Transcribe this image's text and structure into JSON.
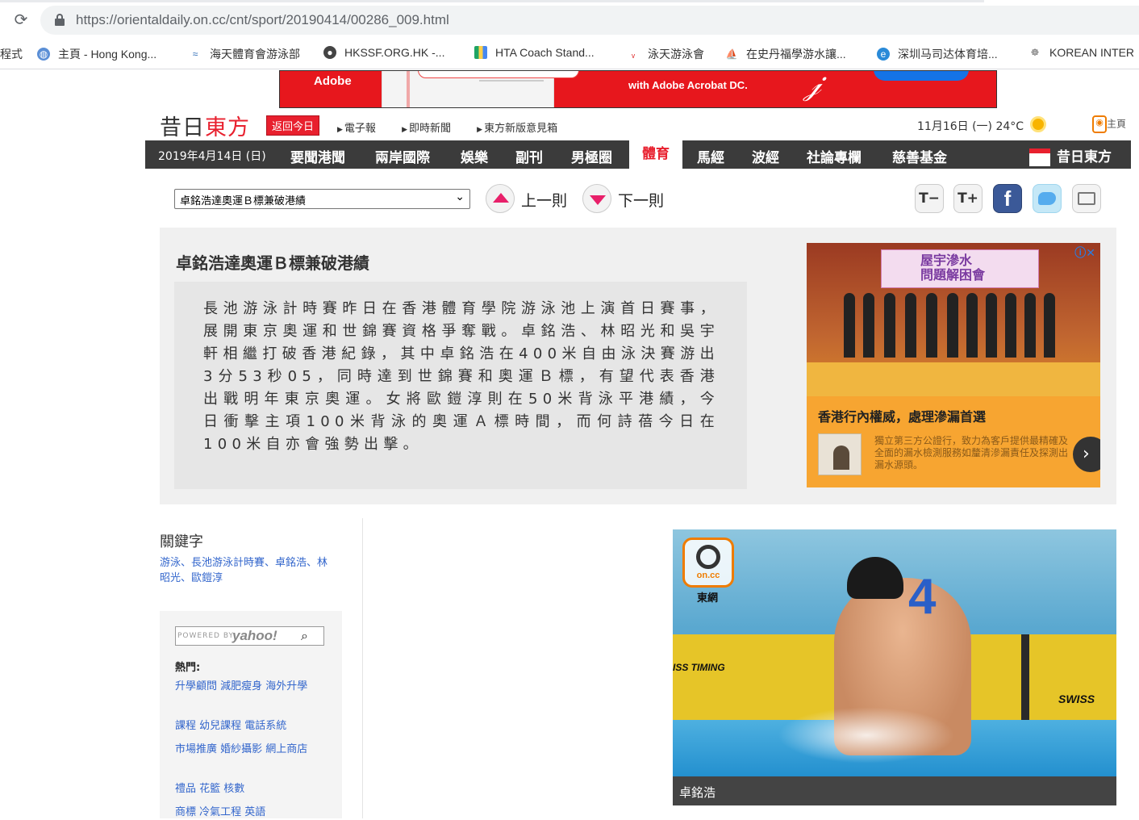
{
  "browser": {
    "url": "https://orientaldaily.on.cc/cnt/sport/20190414/00286_009.html",
    "bookmarks": [
      {
        "label": "程式",
        "icon": "apps-icon"
      },
      {
        "label": "主頁 - Hong Kong...",
        "icon": "globe-icon"
      },
      {
        "label": "海天體育會游泳部",
        "icon": "wave-icon"
      },
      {
        "label": "HKSSF.ORG.HK -...",
        "icon": "hkssf-icon"
      },
      {
        "label": "HTA Coach Stand...",
        "icon": "drive-icon"
      },
      {
        "label": "泳天游泳會",
        "icon": "swim-club-icon"
      },
      {
        "label": "在史丹福學游水讓...",
        "icon": "boat-icon"
      },
      {
        "label": "深圳马司达体育培...",
        "icon": "ie-icon"
      },
      {
        "label": "KOREAN INTER",
        "icon": "korean-icon"
      }
    ]
  },
  "top_ad": {
    "brand": "Adobe",
    "text": "with Adobe Acrobat DC."
  },
  "header": {
    "logo_part1": "昔日",
    "logo_part2": "東方",
    "back_today": "返回今日",
    "links": [
      "電子報",
      "即時新聞",
      "東方新版意見箱"
    ],
    "weather": "11月16日 (一) 24°C",
    "home": "主頁"
  },
  "nav": {
    "date": "2019年4月14日 (日)",
    "items": [
      "要聞港聞",
      "兩岸國際",
      "娛樂",
      "副刊",
      "男極圈",
      "體育",
      "馬經",
      "波經",
      "社論專欄",
      "慈善基金"
    ],
    "active": "體育",
    "brand": "昔日東方"
  },
  "toolbar": {
    "selected_article": "卓銘浩達奧運Ｂ標兼破港績",
    "prev_label": "上一則",
    "next_label": "下一則",
    "font_smaller": "T−",
    "font_larger": "T+",
    "facebook": "f"
  },
  "article": {
    "headline": "卓銘浩達奧運Ｂ標兼破港績",
    "body": "長池游泳計時賽昨日在香港體育學院游泳池上演首日賽事，展開東京奧運和世錦賽資格爭奪戰。卓銘浩、林昭光和吳宇軒相繼打破香港紀錄，其中卓銘浩在400米自由泳決賽游出3分53秒05，同時達到世錦賽和奧運Ｂ標，有望代表香港出戰明年東京奧運。女將歐鎧淳則在50米背泳平港績，今日衝擊主項100米背泳的奧運Ａ標時間，而何詩蓓今日在100米自亦會強勢出擊。"
  },
  "side_ad": {
    "banner": "屋宇滲水\n問題解困會",
    "tagline": "香港行內權威，處理滲漏首選",
    "description": "獨立第三方公證行，致力為客戶提供最精確及全面的漏水檢測服務如釐清滲漏責任及探測出漏水源頭。",
    "next": "›",
    "marker": "ⓘ✕"
  },
  "keywords": {
    "title": "關鍵字",
    "list": "游泳、長池游泳計時賽、卓銘浩、林昭光、歐鎧淳"
  },
  "search": {
    "powered": "POWERED BY",
    "brand": "yahoo!",
    "hot_title": "熱門:",
    "hot_rows": [
      "升學顧問  減肥瘦身  海外升學",
      "課程  幼兒課程  電話系統",
      "市場推廣  婚紗攝影  網上商店",
      "禮品  花籃  核數",
      "商標  冷氣工程  英語"
    ]
  },
  "photo": {
    "logo_text": "on.cc",
    "logo_label": "東網",
    "lane_number": "4",
    "timing_left": "ISS TIMING",
    "timing_right": "SWISS",
    "caption": "卓銘浩"
  }
}
